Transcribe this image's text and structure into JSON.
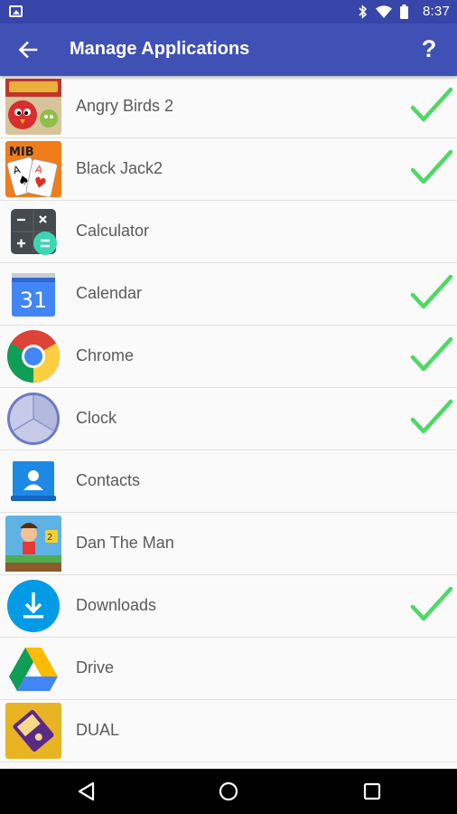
{
  "status_bar": {
    "time": "8:37",
    "icons": [
      "image-notification-icon",
      "bluetooth-icon",
      "wifi-icon",
      "battery-icon"
    ]
  },
  "app_bar": {
    "title": "Manage Applications",
    "back_icon": "arrow-left-icon",
    "help_label": "?"
  },
  "apps": [
    {
      "name": "Angry Birds 2",
      "icon": "angry-birds-icon",
      "checked": true
    },
    {
      "name": "Black Jack2",
      "icon": "blackjack-icon",
      "checked": true
    },
    {
      "name": "Calculator",
      "icon": "calculator-icon",
      "checked": false
    },
    {
      "name": "Calendar",
      "icon": "calendar-icon",
      "icon_text": "31",
      "checked": true
    },
    {
      "name": "Chrome",
      "icon": "chrome-icon",
      "checked": true
    },
    {
      "name": "Clock",
      "icon": "clock-icon",
      "checked": true
    },
    {
      "name": "Contacts",
      "icon": "contacts-icon",
      "checked": false
    },
    {
      "name": "Dan The Man",
      "icon": "dan-the-man-icon",
      "checked": false
    },
    {
      "name": "Downloads",
      "icon": "downloads-icon",
      "checked": true
    },
    {
      "name": "Drive",
      "icon": "drive-icon",
      "checked": false
    },
    {
      "name": "DUAL",
      "icon": "dual-icon",
      "checked": false
    }
  ],
  "blackjack_icon_text": "MIB",
  "nav_bar": {
    "buttons": [
      "back-triangle-icon",
      "home-circle-icon",
      "recents-square-icon"
    ]
  },
  "colors": {
    "status_bar": "#3746a8",
    "app_bar": "#3f51b5",
    "check": "#4cd964",
    "nav_bar": "#000000"
  }
}
